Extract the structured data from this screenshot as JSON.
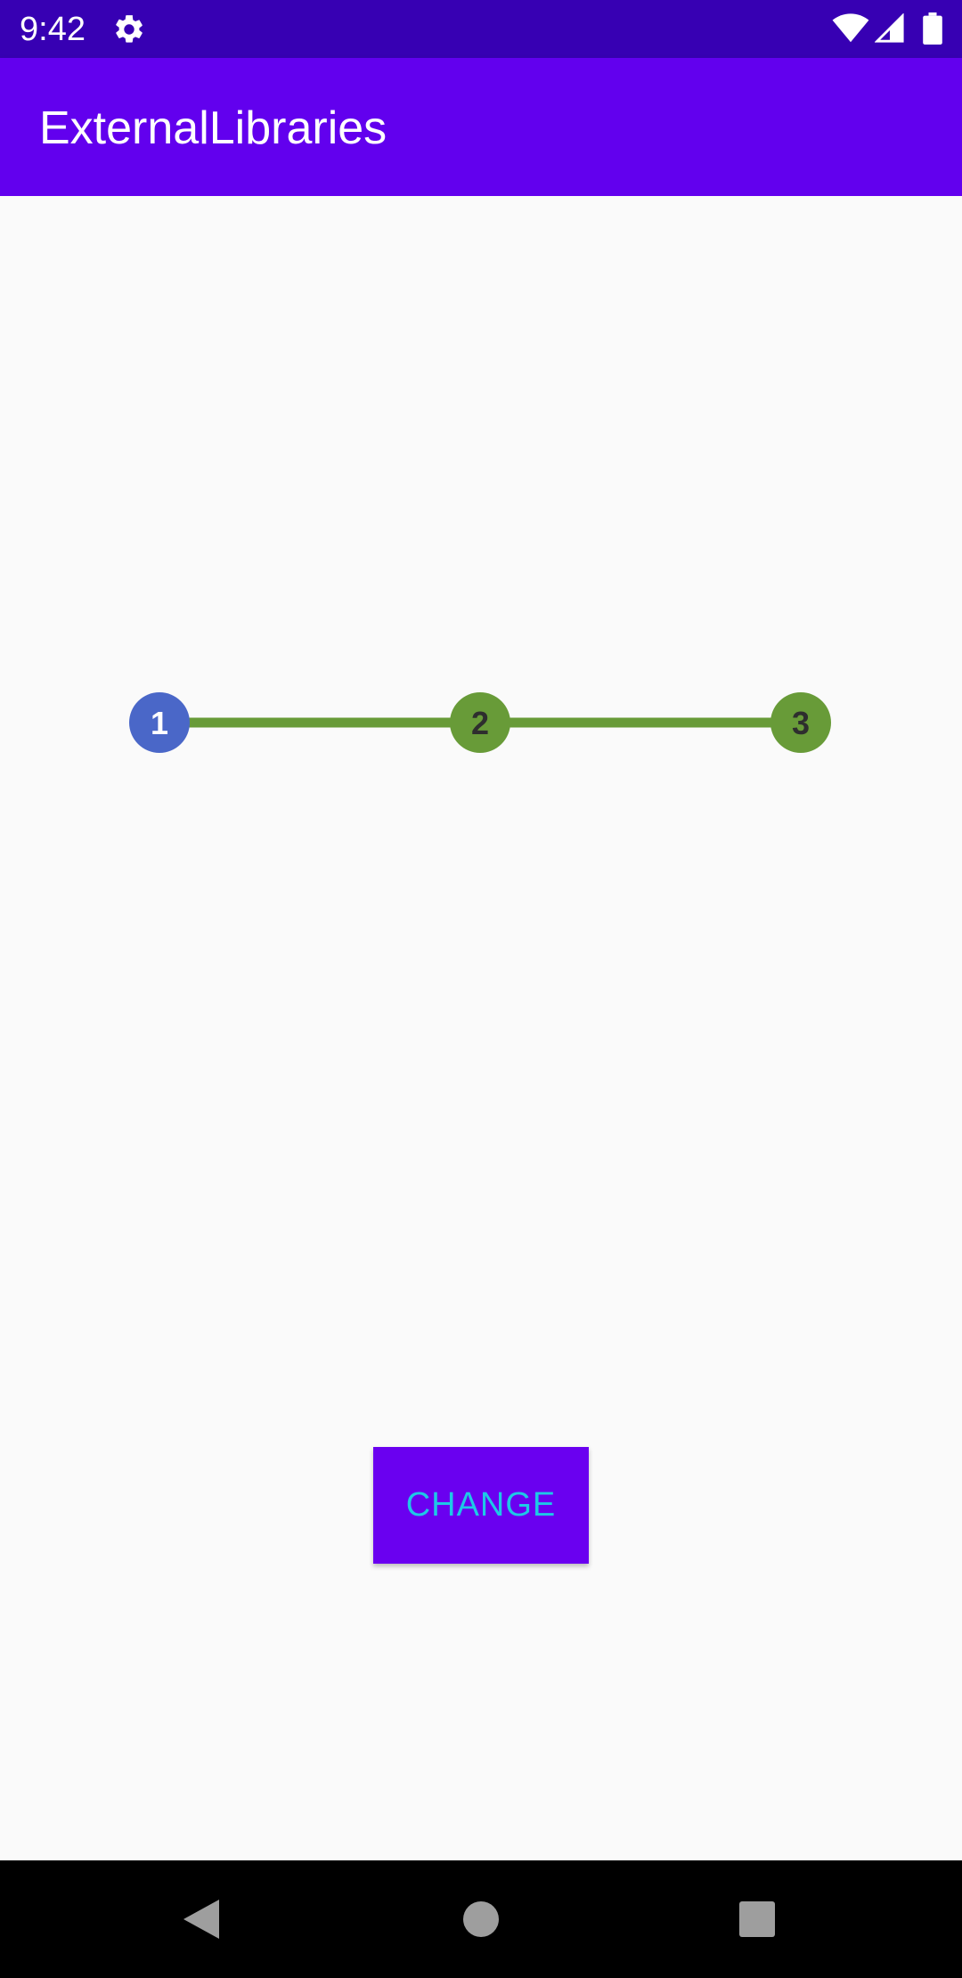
{
  "status_bar": {
    "time": "9:42",
    "icons": [
      "settings-icon",
      "wifi-icon",
      "signal-icon",
      "battery-icon"
    ]
  },
  "app_bar": {
    "title": "ExternalLibraries"
  },
  "stepper": {
    "steps": [
      "1",
      "2",
      "3"
    ],
    "current_step": 1,
    "colors": {
      "active": "#4a67c8",
      "inactive": "#689b38",
      "line": "#689b38",
      "active_text": "#ffffff",
      "inactive_text": "#2e2e2e"
    }
  },
  "change_button": {
    "label": "CHANGE"
  },
  "nav_bar": {
    "icons": [
      "back-icon",
      "home-icon",
      "recents-icon"
    ]
  },
  "colors": {
    "status_bar": "#3700b3",
    "app_bar": "#6200ee",
    "button_bg": "#6a00f0",
    "button_text": "#1ec8e6",
    "background": "#fafafa"
  }
}
